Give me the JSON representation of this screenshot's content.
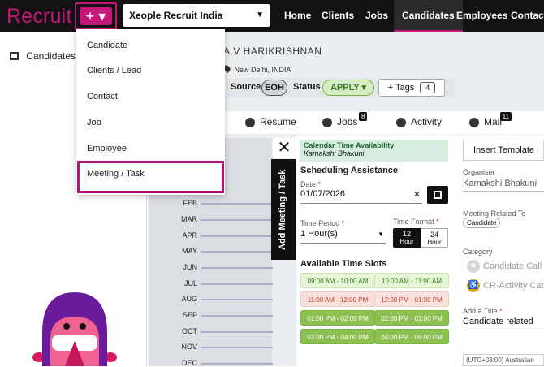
{
  "topbar": {
    "logo": "Recruit",
    "plus_label": "+ ▾",
    "org_select": "Xeople Recruit India",
    "nav": [
      "Home",
      "Clients",
      "Jobs",
      "Candidates",
      "Employees",
      "Contacts"
    ],
    "active_nav": "Candidates"
  },
  "plus_menu": {
    "items": [
      "Candidate",
      "Clients / Lead",
      "Contact",
      "Job",
      "Employee",
      "Meeting / Task"
    ],
    "highlighted": "Meeting / Task"
  },
  "sidebar": {
    "candidates_label": "Candidates"
  },
  "record": {
    "name": "A.V HARIKRISHNAN",
    "location": "New Delhi, INDIA",
    "source_label": "Source",
    "source_value": "EOH",
    "status_label": "Status",
    "status_value": "APPLY",
    "tags_label": "Tags",
    "tags_count": "4"
  },
  "tabs": [
    {
      "label": "Resume",
      "badge": ""
    },
    {
      "label": "Jobs",
      "badge": "8"
    },
    {
      "label": "Activity",
      "badge": ""
    },
    {
      "label": "Mail",
      "badge": "11"
    }
  ],
  "chart_months": [
    "FEB",
    "MAR",
    "APR",
    "MAY",
    "JUN",
    "JUL",
    "AUG",
    "SEP",
    "OCT",
    "NOV",
    "DEC"
  ],
  "meeting_panel": {
    "side_tab": "Add Meeting / Task",
    "close": "✕",
    "calendar_title": "Calendar Time Availability",
    "calendar_person": "Kamakshi Bhakuni",
    "scheduling_title": "Scheduling Assistance",
    "date_label": "Date",
    "date_value": "01/07/2026",
    "time_period_label": "Time Period",
    "time_period_value": "1 Hour(s)",
    "time_format_label": "Time Format",
    "format_12": "12",
    "format_24": "24",
    "format_unit": "Hour",
    "slots_title": "Available Time Slots",
    "slots": [
      {
        "label": "09:00 AM - 10:00 AM",
        "style": "light"
      },
      {
        "label": "10:00 AM - 11:00 AM",
        "style": "light"
      },
      {
        "label": "11:00 AM - 12:00 PM",
        "style": "red"
      },
      {
        "label": "12:00 PM - 01:00 PM",
        "style": "red"
      },
      {
        "label": "01:00 PM - 02:00 PM",
        "style": "green"
      },
      {
        "label": "02:00 PM - 03:00 PM",
        "style": "green"
      },
      {
        "label": "03:00 PM - 04:00 PM",
        "style": "green"
      },
      {
        "label": "04:00 PM - 05:00 PM",
        "style": "green"
      }
    ]
  },
  "right_panel": {
    "insert_template": "Insert Template",
    "organiser_label": "Organiser",
    "organiser_value": "Kamakshi Bhakuni",
    "related_label": "Meeting Related To",
    "related_value": "Candidate",
    "category_label": "Category",
    "category_1": "Candidate Call",
    "category_2": "CR-Activity Category",
    "title_label": "Add a Title",
    "title_value": "Candidate related",
    "timezone": "(UTC+08:00) Australian"
  },
  "colors": {
    "brand": "#c2187a",
    "topbar": "#121212",
    "slot_green": "#8cc152"
  }
}
